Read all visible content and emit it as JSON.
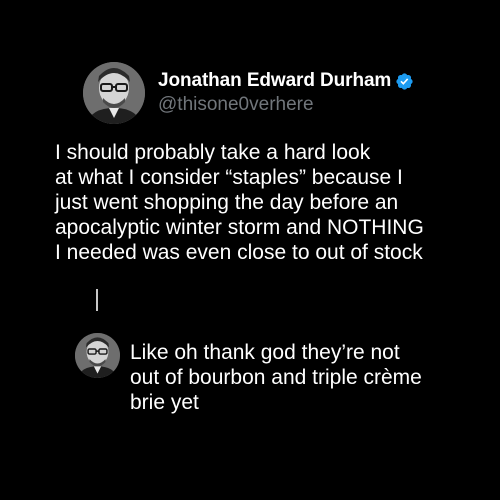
{
  "tweet": {
    "author_name": "Jonathan Edward Durham",
    "handle": "@thisone0verhere",
    "verified": true,
    "avatar_icon": "portrait-man-glasses-avatar",
    "text_lines": [
      "I should probably take a hard look",
      "at what I consider “staples” because I",
      "just went shopping the day before an",
      "apocalyptic winter storm and NOTHING",
      "I needed was even close to out of stock"
    ]
  },
  "reply": {
    "avatar_icon": "portrait-man-glasses-avatar",
    "text_lines": [
      "Like oh thank god they’re not",
      "out of bourbon and triple crème",
      "brie yet"
    ]
  },
  "colors": {
    "background": "#000000",
    "text": "#ffffff",
    "handle": "#71767b",
    "verified": "#1d9bf0",
    "thread_line": "#c7c7c7"
  }
}
